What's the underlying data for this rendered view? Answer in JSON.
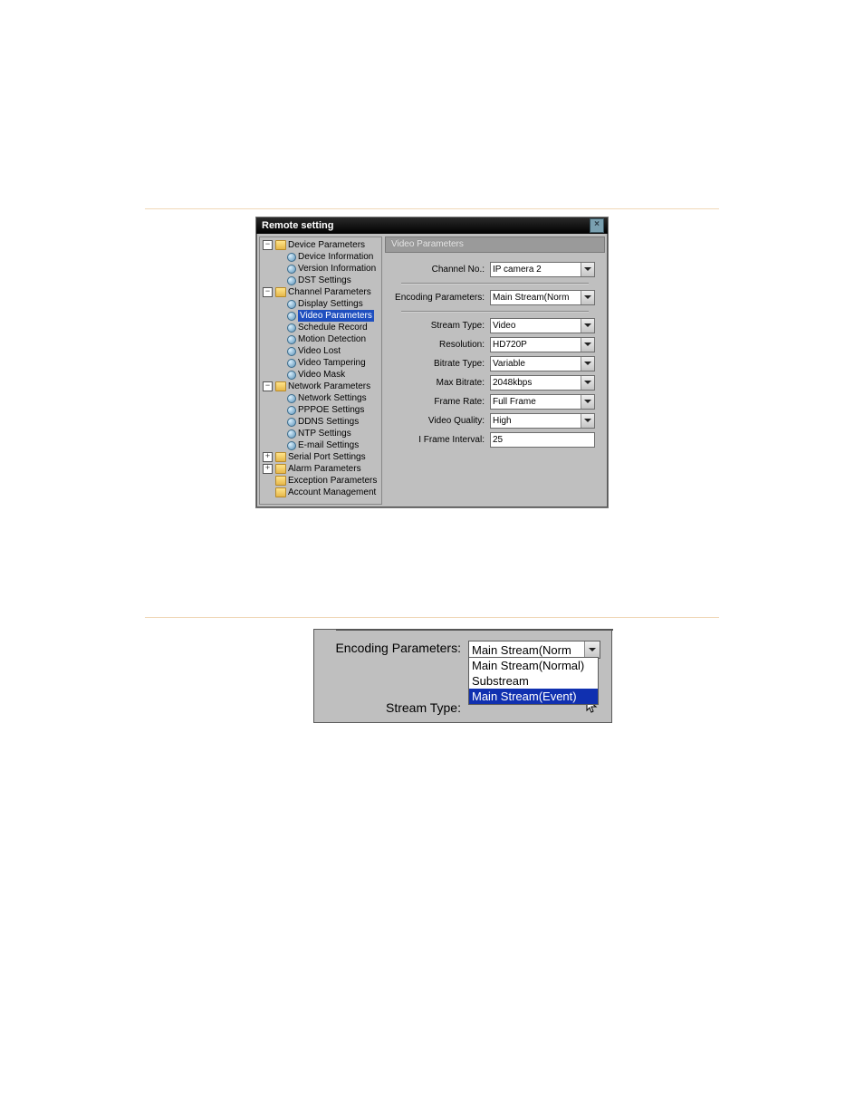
{
  "window": {
    "title": "Remote setting"
  },
  "tree": {
    "n_device": "Device Parameters",
    "n_devinfo": "Device Information",
    "n_verinfo": "Version Information",
    "n_dst": "DST Settings",
    "n_channel": "Channel Parameters",
    "n_display": "Display Settings",
    "n_video": "Video Parameters",
    "n_schedule": "Schedule Record",
    "n_motion": "Motion Detection",
    "n_vlost": "Video Lost",
    "n_vtamp": "Video Tampering",
    "n_vmask": "Video Mask",
    "n_network": "Network Parameters",
    "n_netset": "Network Settings",
    "n_pppoe": "PPPOE Settings",
    "n_ddns": "DDNS Settings",
    "n_ntp": "NTP Settings",
    "n_email": "E-mail Settings",
    "n_serial": "Serial Port Settings",
    "n_alarm": "Alarm Parameters",
    "n_except": "Exception Parameters",
    "n_account": "Account Management"
  },
  "section_title": "Video Parameters",
  "labels": {
    "channel_no": "Channel No.:",
    "encoding": "Encoding Parameters:",
    "stream": "Stream Type:",
    "resolution": "Resolution:",
    "bitrate_t": "Bitrate Type:",
    "max_bitrate": "Max Bitrate:",
    "frame_rate": "Frame Rate:",
    "vquality": "Video Quality:",
    "iframe": "I Frame Interval:"
  },
  "values": {
    "channel_no": "IP camera 2",
    "encoding": "Main Stream(Norm",
    "stream": "Video",
    "resolution": "HD720P",
    "bitrate_t": "Variable",
    "max_bitrate": "2048kbps",
    "frame_rate": "Full Frame",
    "vquality": "High",
    "iframe": "25"
  },
  "snippet": {
    "encoding_label": "Encoding Parameters:",
    "encoding_value": "Main Stream(Norm",
    "stream_label": "Stream Type:",
    "options": {
      "o1": "Main Stream(Normal)",
      "o2": "Substream",
      "o3": "Main Stream(Event)"
    }
  }
}
